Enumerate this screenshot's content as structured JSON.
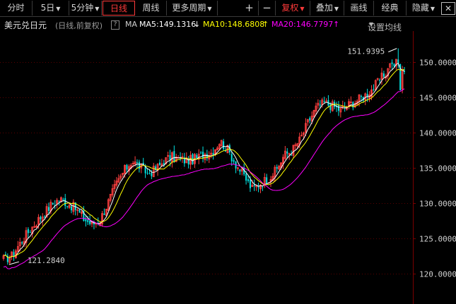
{
  "toolbar": {
    "items": [
      {
        "label": "分时"
      },
      {
        "label": "5日",
        "dropdown": true
      },
      {
        "label": "5分钟",
        "dropdown": true
      },
      {
        "label": "日线",
        "active": true
      },
      {
        "label": "周线"
      },
      {
        "label": "更多周期",
        "dropdown": true
      },
      {
        "label": "+"
      },
      {
        "label": "−"
      },
      {
        "label": "复权",
        "dropdown": true,
        "accent": true
      },
      {
        "label": "叠加",
        "dropdown": true
      },
      {
        "label": "画线"
      },
      {
        "label": "经典"
      },
      {
        "label": "隐藏",
        "dropdown": true
      }
    ],
    "close_icon": "close-icon"
  },
  "legend": {
    "instrument": "美元兑日元",
    "period": "(日线,前复权)",
    "help": "?",
    "ma_label": "MA",
    "ma5": "MA5:149.1316",
    "ma5_arrow": "↓",
    "ma10": "MA10:148.6808",
    "ma10_arrow": "↑",
    "ma20": "MA20:146.7797",
    "ma20_arrow": "↑",
    "settings": "设置均线"
  },
  "colors": {
    "up": "#ff4040",
    "down": "#00e5e5",
    "ma5": "#ffffff",
    "ma10": "#ffff00",
    "ma20": "#ff00ff",
    "accent": "#ff3a3a"
  },
  "chart_data": {
    "type": "candlestick",
    "title": "美元兑日元",
    "ylim": [
      118,
      153
    ],
    "y_ticks": [
      "150.0000",
      "145.0000",
      "140.0000",
      "135.0000",
      "130.0000",
      "125.0000",
      "120.0000"
    ],
    "high_annotation": "151.9395",
    "low_annotation": "121.2840",
    "close_path": [
      122.0,
      122.5,
      124.2,
      125.8,
      127.2,
      128.5,
      129.8,
      130.6,
      130.0,
      129.2,
      127.8,
      127.0,
      127.5,
      130.0,
      132.5,
      134.5,
      136.0,
      135.2,
      134.2,
      134.8,
      136.0,
      136.5,
      136.2,
      136.0,
      136.3,
      137.0,
      137.2,
      138.8,
      137.5,
      135.5,
      133.8,
      132.0,
      132.8,
      133.5,
      134.6,
      136.8,
      137.5,
      139.0,
      141.5,
      143.5,
      144.2,
      143.8,
      143.2,
      143.9,
      144.5,
      145.2,
      146.2,
      147.5,
      149.0,
      150.0,
      148.8
    ]
  }
}
